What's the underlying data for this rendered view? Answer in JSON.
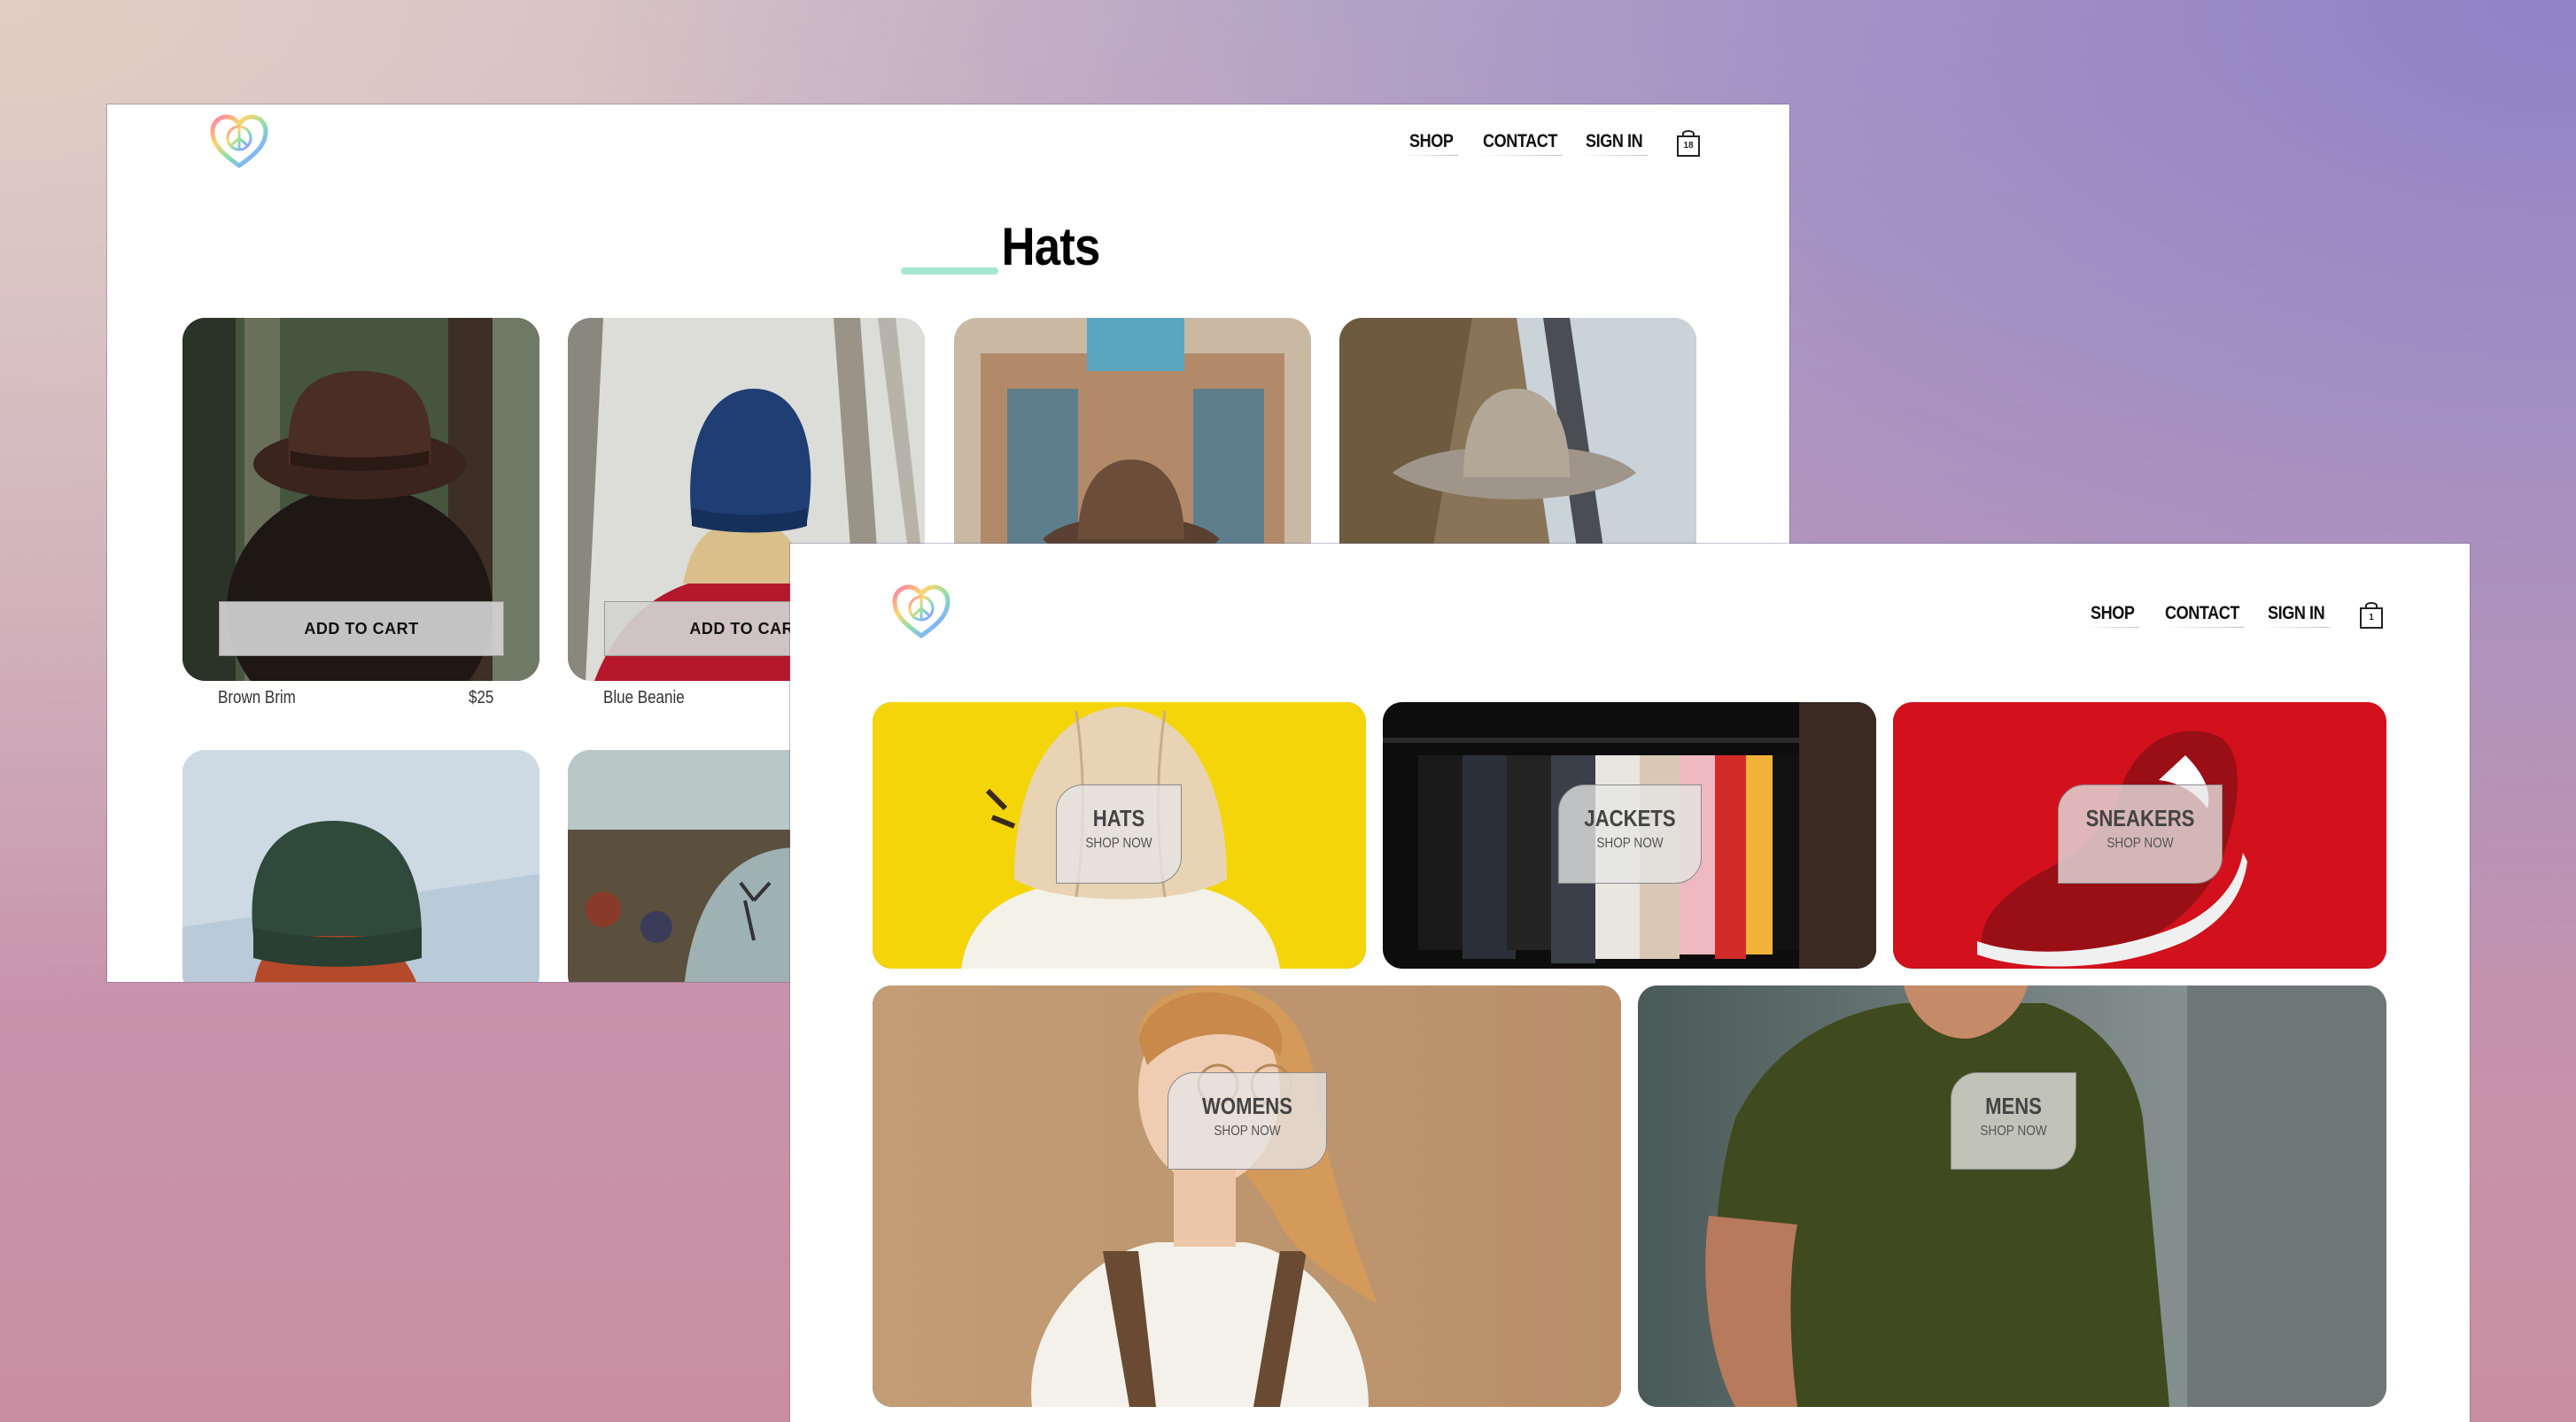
{
  "colors": {
    "accent_underline": "#a8e6d4",
    "nav_text": "#111111",
    "label_bg": "#e6e6e6"
  },
  "back_window": {
    "nav": {
      "shop": "SHOP",
      "contact": "CONTACT",
      "signin": "SIGN IN",
      "cart_count": "18"
    },
    "title": "Hats",
    "products": [
      {
        "name": "Brown Brim",
        "price": "$25",
        "button": "ADD TO CART",
        "icon": "brown-fedora-photo"
      },
      {
        "name": "Blue Beanie",
        "price": "",
        "button": "ADD TO CART",
        "icon": "blue-beanie-photo"
      },
      {
        "name": "",
        "price": "",
        "button": "",
        "icon": "brown-cowboy-hat-photo"
      },
      {
        "name": "",
        "price": "",
        "button": "",
        "icon": "grey-cowboy-hat-photo"
      },
      {
        "name": "",
        "price": "",
        "button": "",
        "icon": "green-beanie-photo"
      },
      {
        "name": "",
        "price": "",
        "button": "",
        "icon": "palm-tree-cap-photo"
      }
    ]
  },
  "front_window": {
    "nav": {
      "shop": "SHOP",
      "contact": "CONTACT",
      "signin": "SIGN IN",
      "cart_count": "1"
    },
    "categories": [
      {
        "title": "HATS",
        "subtitle": "SHOP NOW",
        "icon": "cap-on-yellow-photo"
      },
      {
        "title": "JACKETS",
        "subtitle": "SHOP NOW",
        "icon": "jacket-rack-photo"
      },
      {
        "title": "SNEAKERS",
        "subtitle": "SHOP NOW",
        "icon": "red-sneaker-photo"
      },
      {
        "title": "WOMENS",
        "subtitle": "SHOP NOW",
        "icon": "woman-portrait-photo"
      },
      {
        "title": "MENS",
        "subtitle": "SHOP NOW",
        "icon": "man-green-tee-photo"
      }
    ]
  }
}
